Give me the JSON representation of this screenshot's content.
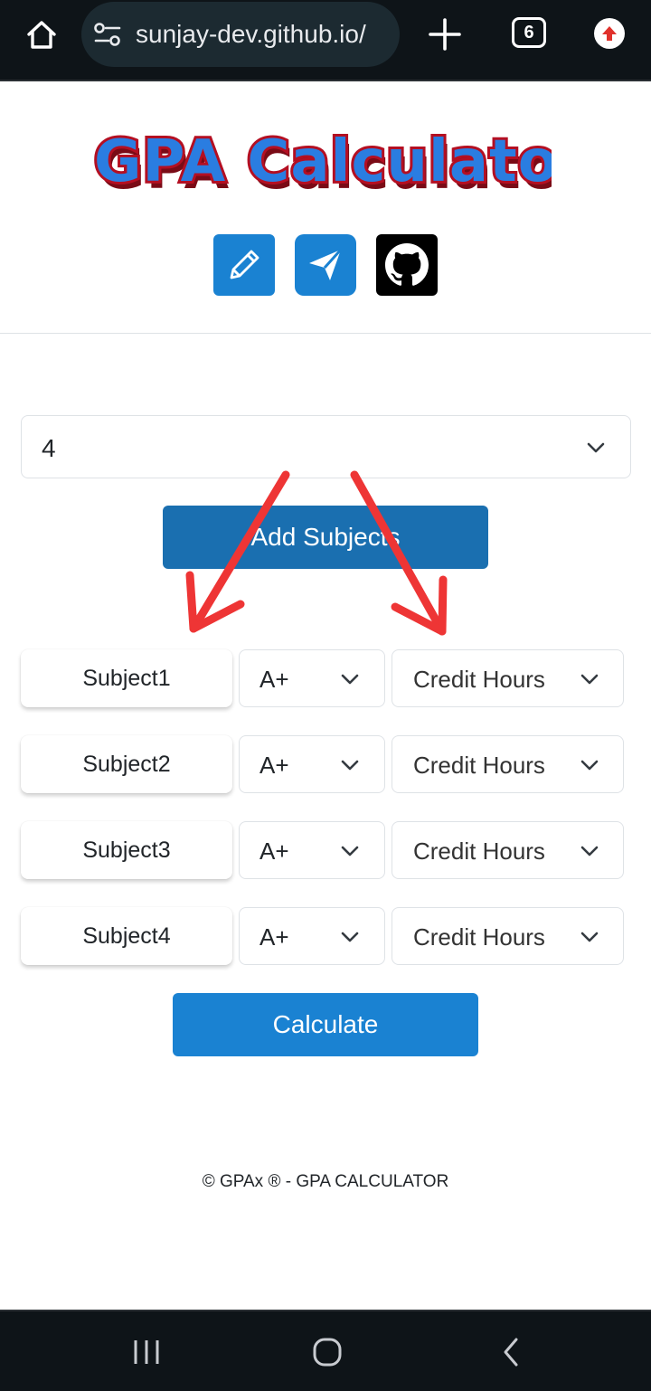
{
  "browser": {
    "url": "sunjay-dev.github.io/",
    "tab_count": "6",
    "icons": {
      "home": "home-icon",
      "site_settings": "tune-icon",
      "new_tab": "plus-icon",
      "tabs": "tabs-counter-icon",
      "update": "arrow-up-circle-icon"
    }
  },
  "header": {
    "logo_text": "GPA Calculator",
    "links": [
      {
        "name": "edit",
        "icon": "pencil-icon",
        "color": "#1a82d2"
      },
      {
        "name": "telegram",
        "icon": "paper-plane-icon",
        "color": "#1a82d2"
      },
      {
        "name": "github",
        "icon": "github-icon",
        "color": "#000000"
      }
    ]
  },
  "main": {
    "subject_count": "4",
    "add_button": "Add Subjects",
    "subjects": [
      {
        "name": "Subject1",
        "grade": "A+",
        "credit": "Credit Hours"
      },
      {
        "name": "Subject2",
        "grade": "A+",
        "credit": "Credit Hours"
      },
      {
        "name": "Subject3",
        "grade": "A+",
        "credit": "Credit Hours"
      },
      {
        "name": "Subject4",
        "grade": "A+",
        "credit": "Credit Hours"
      }
    ],
    "calculate_button": "Calculate"
  },
  "footer": {
    "text": "© GPAx ® - GPA CALCULATOR"
  },
  "annotation": {
    "arrow_color": "#ee3535"
  },
  "nav": {
    "icons": [
      "recent-apps-icon",
      "home-circle-icon",
      "back-icon"
    ]
  },
  "colors": {
    "primary": "#1a82d2",
    "add_button": "#1a6fb0",
    "browser_bg": "#0e1418"
  }
}
